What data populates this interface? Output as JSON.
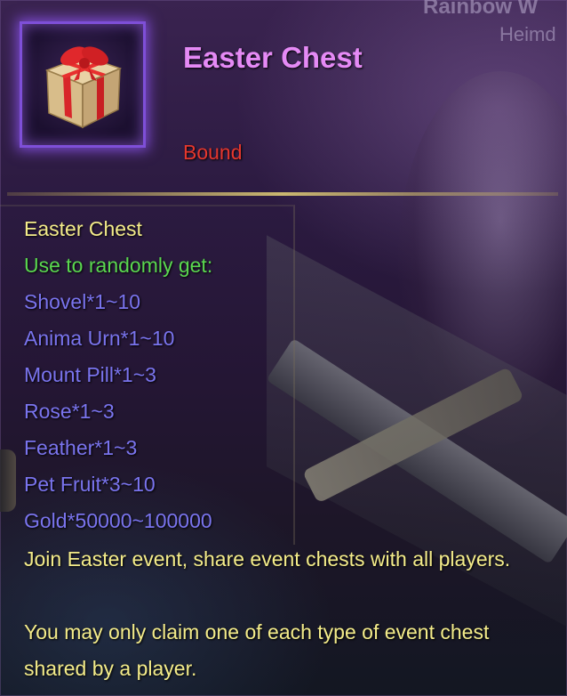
{
  "background_text": {
    "top": "Rainbow W",
    "right": "Heimd"
  },
  "item": {
    "icon": "gift-box-icon",
    "title": "Easter Chest",
    "binding": "Bound"
  },
  "description": {
    "name": "Easter Chest",
    "use_text": "Use to randomly get:",
    "rewards": [
      "Shovel*1~10",
      "Anima Urn*1~10",
      "Mount Pill*1~3",
      "Rose*1~3",
      "Feather*1~3",
      "Pet Fruit*3~10",
      "Gold*50000~100000"
    ],
    "event_note": "Join Easter event, share event chests with all players.",
    "claim_note": "You may only claim one of each type of event chest shared by a player."
  },
  "colors": {
    "title": "#e58af5",
    "bound": "#e5372d",
    "name": "#f4ec8a",
    "use": "#5ad84f",
    "reward": "#7a74ee"
  }
}
